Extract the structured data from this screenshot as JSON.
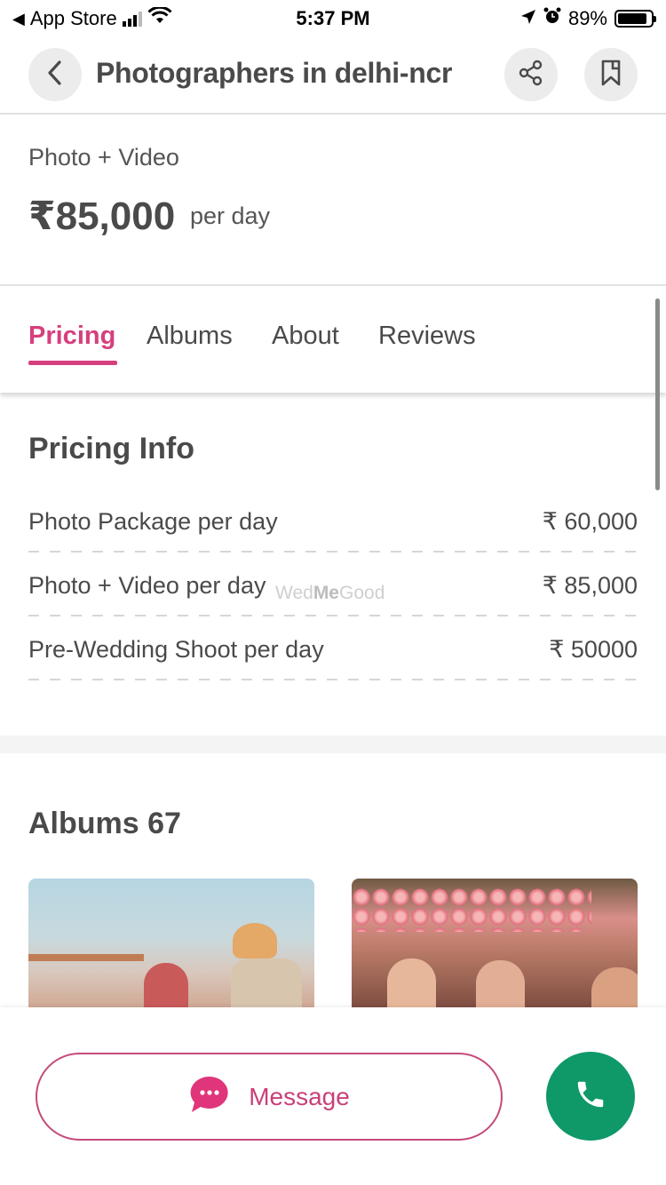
{
  "status_bar": {
    "back_app": "App Store",
    "time": "5:37 PM",
    "battery": "89%",
    "battery_level": 0.89
  },
  "header": {
    "title": "Photographers in delhi-ncr",
    "icons": {
      "back": "chevron-left-icon",
      "share": "share-icon",
      "bookmark": "bookmark-icon"
    }
  },
  "price_summary": {
    "label": "Photo + Video",
    "price": "₹85,000",
    "unit": "per day"
  },
  "tabs": [
    {
      "label": "Pricing",
      "active": true
    },
    {
      "label": "Albums",
      "active": false
    },
    {
      "label": "About",
      "active": false
    },
    {
      "label": "Reviews",
      "active": false
    }
  ],
  "pricing_info": {
    "title": "Pricing Info",
    "rows": [
      {
        "name": "Photo Package per day",
        "value": "₹ 60,000"
      },
      {
        "name": "Photo + Video per day",
        "value": "₹ 85,000"
      },
      {
        "name": "Pre-Wedding Shoot per day",
        "value": "₹ 50000"
      }
    ],
    "watermark_pre": "Wed",
    "watermark_bold": "Me",
    "watermark_post": "Good"
  },
  "albums": {
    "title": "Albums 67",
    "items": [
      {
        "alt": "Couple at wedding mandap"
      },
      {
        "alt": "Bride under floral phoolon ki chadar"
      }
    ]
  },
  "bottom_bar": {
    "message_label": "Message",
    "accent_color": "#d63f7d",
    "call_color": "#0f9868"
  }
}
